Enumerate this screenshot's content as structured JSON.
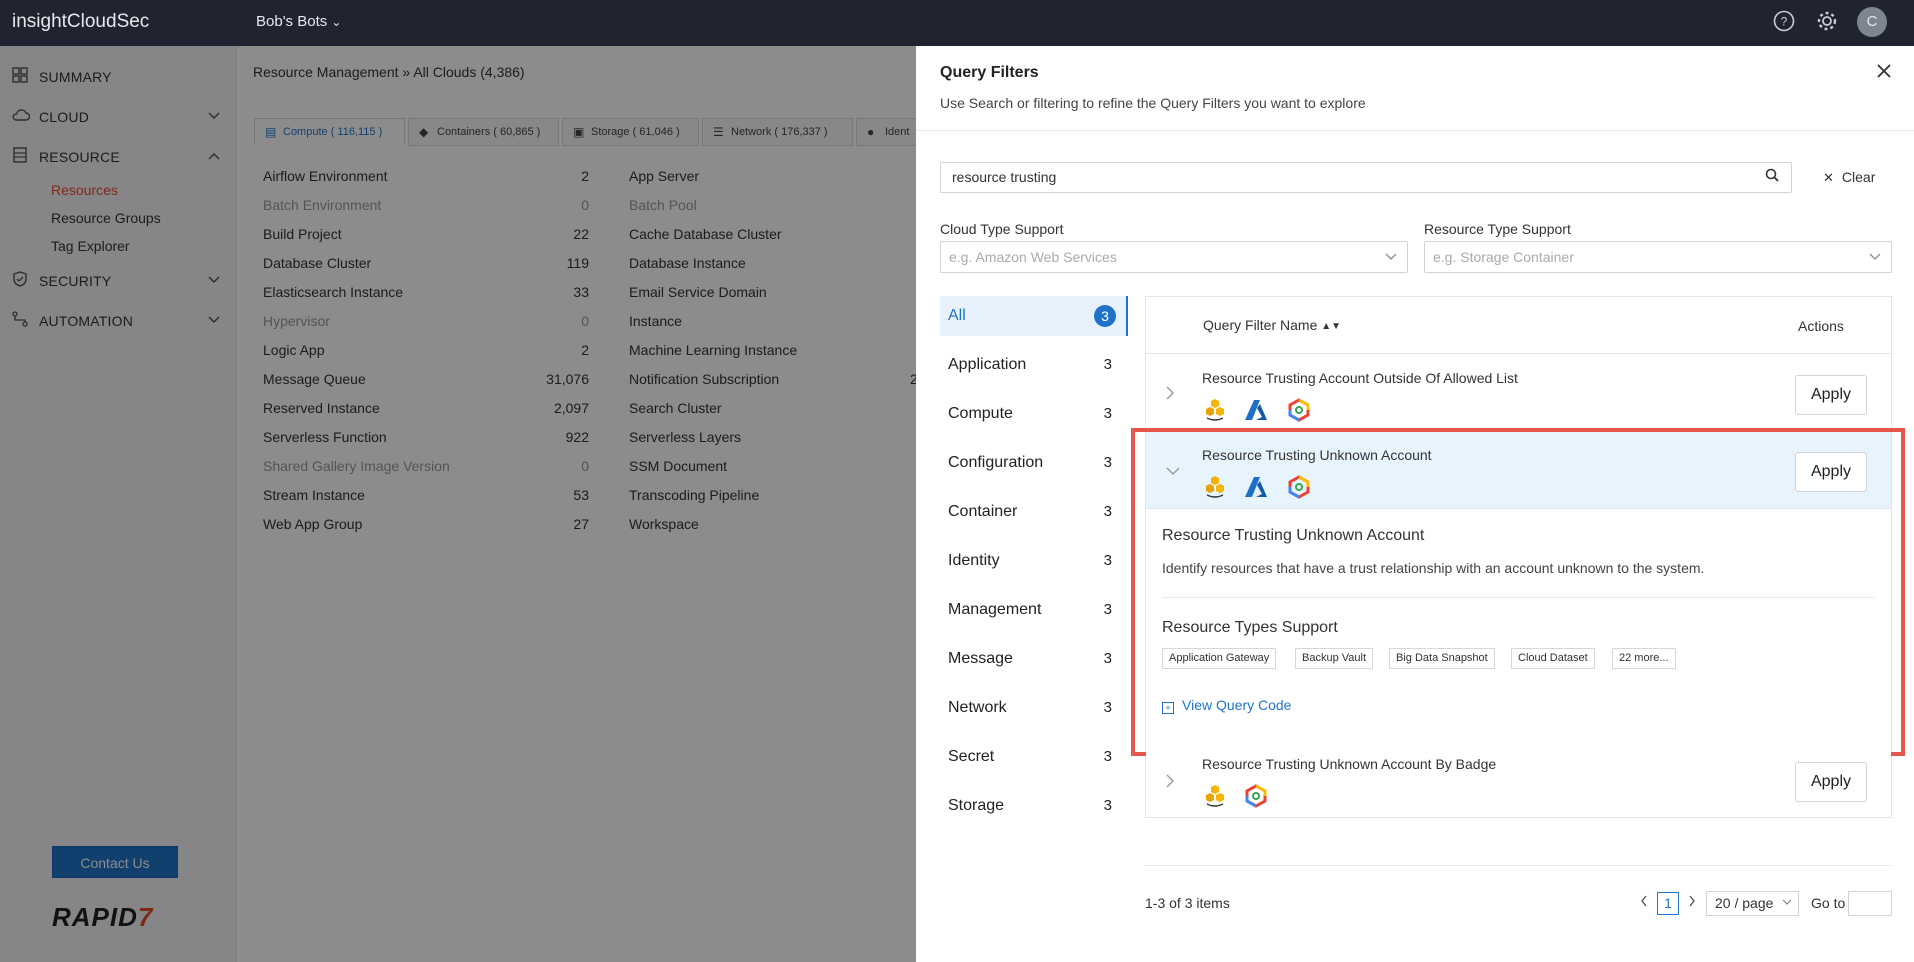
{
  "topbar": {
    "app_name": "insightCloudSec",
    "org": "Bob's Bots",
    "org_chevron": "⌄",
    "help_icon": "?",
    "settings_icon": "⚙",
    "avatar": "C"
  },
  "sidebar": {
    "items": [
      {
        "label": "SUMMARY",
        "icon": "grid-icon"
      },
      {
        "label": "CLOUD",
        "icon": "cloud-icon"
      },
      {
        "label": "RESOURCE",
        "icon": "database-icon"
      },
      {
        "label": "SECURITY",
        "icon": "shield-icon"
      },
      {
        "label": "AUTOMATION",
        "icon": "automation-icon"
      }
    ],
    "subitems": [
      "Resources",
      "Resource Groups",
      "Tag Explorer"
    ],
    "contact": "Contact Us",
    "brand": "RAPID",
    "brand_mark": "7"
  },
  "main": {
    "breadcrumb": "Resource Management » All Clouds (4,386)",
    "tabs": [
      {
        "label": "Compute ( 116,115 )"
      },
      {
        "label": "Containers ( 60,865 )"
      },
      {
        "label": "Storage ( 61,046 )"
      },
      {
        "label": "Network ( 176,337 )"
      },
      {
        "label": "Ident"
      }
    ],
    "col1": [
      {
        "name": "Airflow Environment",
        "count": "2"
      },
      {
        "name": "Batch Environment",
        "count": "0"
      },
      {
        "name": "Build Project",
        "count": "22"
      },
      {
        "name": "Database Cluster",
        "count": "119"
      },
      {
        "name": "Elasticsearch Instance",
        "count": "33"
      },
      {
        "name": "Hypervisor",
        "count": "0"
      },
      {
        "name": "Logic App",
        "count": "2"
      },
      {
        "name": "Message Queue",
        "count": "31,076"
      },
      {
        "name": "Reserved Instance",
        "count": "2,097"
      },
      {
        "name": "Serverless Function",
        "count": "922"
      },
      {
        "name": "Shared Gallery Image Version",
        "count": "0"
      },
      {
        "name": "Stream Instance",
        "count": "53"
      },
      {
        "name": "Web App Group",
        "count": "27"
      }
    ],
    "col2": [
      {
        "name": "App Server"
      },
      {
        "name": "Batch Pool"
      },
      {
        "name": "Cache Database Cluster"
      },
      {
        "name": "Database Instance"
      },
      {
        "name": "Email Service Domain"
      },
      {
        "name": "Instance"
      },
      {
        "name": "Machine Learning Instance"
      },
      {
        "name": "Notification Subscription",
        "partial": "2"
      },
      {
        "name": "Search Cluster"
      },
      {
        "name": "Serverless Layers"
      },
      {
        "name": "SSM Document"
      },
      {
        "name": "Transcoding Pipeline"
      },
      {
        "name": "Workspace"
      }
    ]
  },
  "panel": {
    "title": "Query Filters",
    "subtitle": "Use Search or filtering to refine the Query Filters you want to explore",
    "search_value": "resource trusting",
    "clear": "Clear",
    "cloud_type_label": "Cloud Type Support",
    "cloud_type_placeholder": "e.g. Amazon Web Services",
    "resource_type_label": "Resource Type Support",
    "resource_type_placeholder": "e.g. Storage Container",
    "categories": [
      {
        "label": "All",
        "count": "3"
      },
      {
        "label": "Application",
        "count": "3"
      },
      {
        "label": "Compute",
        "count": "3"
      },
      {
        "label": "Configuration",
        "count": "3"
      },
      {
        "label": "Container",
        "count": "3"
      },
      {
        "label": "Identity",
        "count": "3"
      },
      {
        "label": "Management",
        "count": "3"
      },
      {
        "label": "Message",
        "count": "3"
      },
      {
        "label": "Network",
        "count": "3"
      },
      {
        "label": "Secret",
        "count": "3"
      },
      {
        "label": "Storage",
        "count": "3"
      }
    ],
    "table": {
      "col_name": "Query Filter Name",
      "col_actions": "Actions",
      "apply": "Apply",
      "rows": [
        {
          "name": "Resource Trusting Account Outside Of Allowed List",
          "clouds": [
            "aws",
            "azure",
            "gcp"
          ]
        },
        {
          "name": "Resource Trusting Unknown Account",
          "clouds": [
            "aws",
            "azure",
            "gcp"
          ],
          "expanded": true
        },
        {
          "name": "Resource Trusting Unknown Account By Badge",
          "clouds": [
            "aws",
            "gcp"
          ]
        }
      ]
    },
    "detail": {
      "title": "Resource Trusting Unknown Account",
      "description": "Identify resources that have a trust relationship with an account unknown to the system.",
      "types_title": "Resource Types Support",
      "tags": [
        "Application Gateway",
        "Backup Vault",
        "Big Data Snapshot",
        "Cloud Dataset",
        "22 more..."
      ],
      "view_code": "View Query Code"
    },
    "pagination": {
      "info": "1-3 of 3 items",
      "page": "1",
      "page_size": "20 / page",
      "goto": "Go to"
    }
  },
  "colors": {
    "accent": "#1f74c9",
    "highlight": "#e4554b",
    "active_nav": "#e8492a"
  }
}
